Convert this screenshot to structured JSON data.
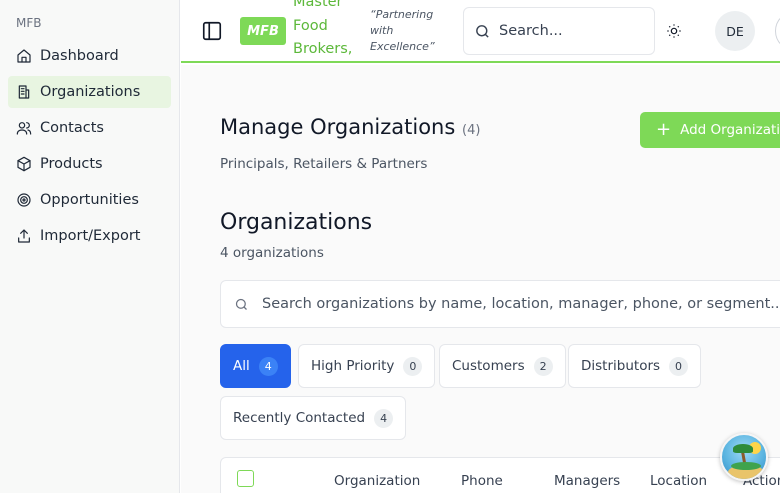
{
  "sidebar": {
    "brand": "MFB",
    "items": [
      {
        "label": "Dashboard",
        "icon": "home-icon"
      },
      {
        "label": "Organizations",
        "icon": "building-icon",
        "active": true
      },
      {
        "label": "Contacts",
        "icon": "users-icon"
      },
      {
        "label": "Products",
        "icon": "package-icon"
      },
      {
        "label": "Opportunities",
        "icon": "target-icon"
      },
      {
        "label": "Import/Export",
        "icon": "upload-icon"
      }
    ]
  },
  "header": {
    "logo": "MFB",
    "company_name": "Master Food Brokers, Inc.",
    "tagline": "“Partnering with Excellence”",
    "search_placeholder": "Search...",
    "avatar_initials": "DE",
    "accent_color": "#7ed957"
  },
  "main": {
    "title": "Manage Organizations",
    "title_count": "(4)",
    "subtitle": "Principals, Retailers & Partners",
    "add_button": "Add Organization",
    "section_title": "Organizations",
    "section_sub": "4 organizations",
    "search_placeholder": "Search organizations by name, location, manager, phone, or segment...",
    "filters": [
      {
        "label": "All",
        "count": "4",
        "active": true
      },
      {
        "label": "High Priority",
        "count": "0"
      },
      {
        "label": "Customers",
        "count": "2"
      },
      {
        "label": "Distributors",
        "count": "0"
      },
      {
        "label": "Recently Contacted",
        "count": "4"
      }
    ],
    "table_columns": [
      "Organization",
      "Phone",
      "Managers",
      "Location",
      "Actions"
    ],
    "active_color": "#2563eb"
  }
}
